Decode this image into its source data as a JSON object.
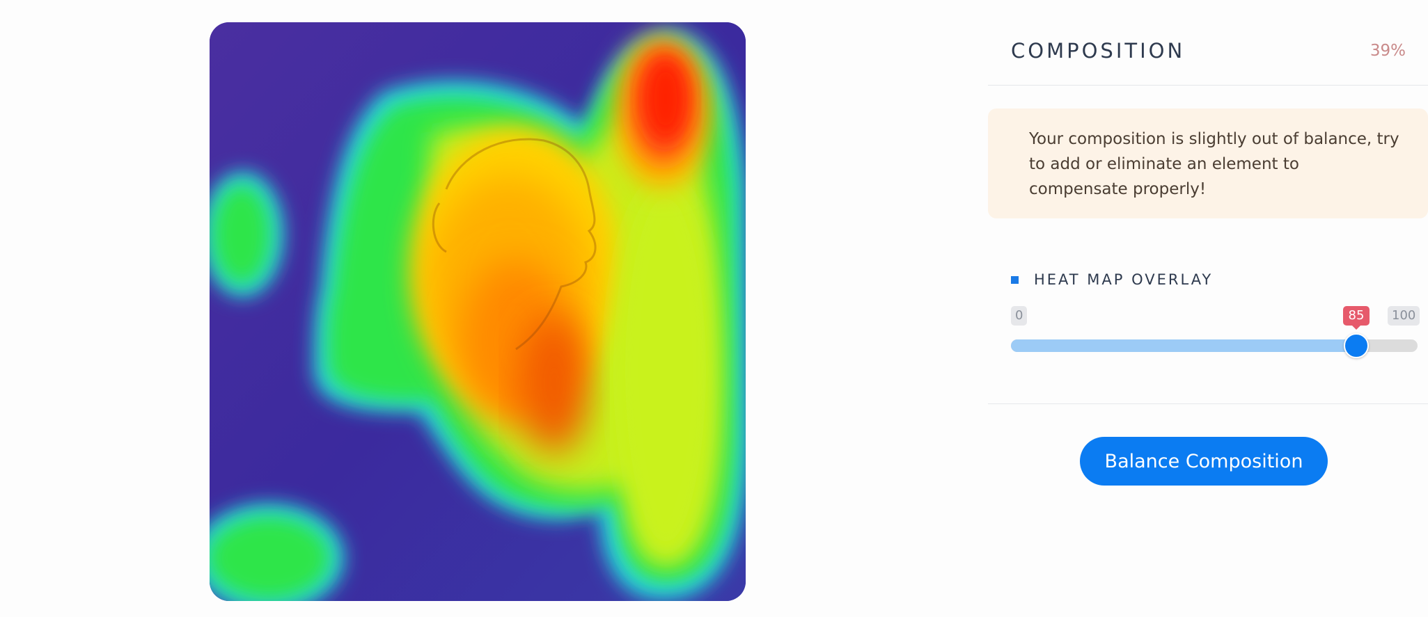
{
  "heatmap": {
    "icon": "heat-map-image"
  },
  "panel": {
    "title": "COMPOSITION",
    "score": "39%",
    "notice": "Your composition is slightly out of balance, try to add or eliminate an element to compensate properly!",
    "overlay": {
      "label": "HEAT MAP OVERLAY",
      "min_label": "0",
      "max_label": "100",
      "value_label": "85",
      "value": 85,
      "min": 0,
      "max": 100
    },
    "button_label": "Balance Composition"
  },
  "colors": {
    "accent": "#0b7cf2",
    "value_tag": "#e65a6b",
    "notice_bg": "#fdf3e7",
    "score": "#c98a8a"
  }
}
